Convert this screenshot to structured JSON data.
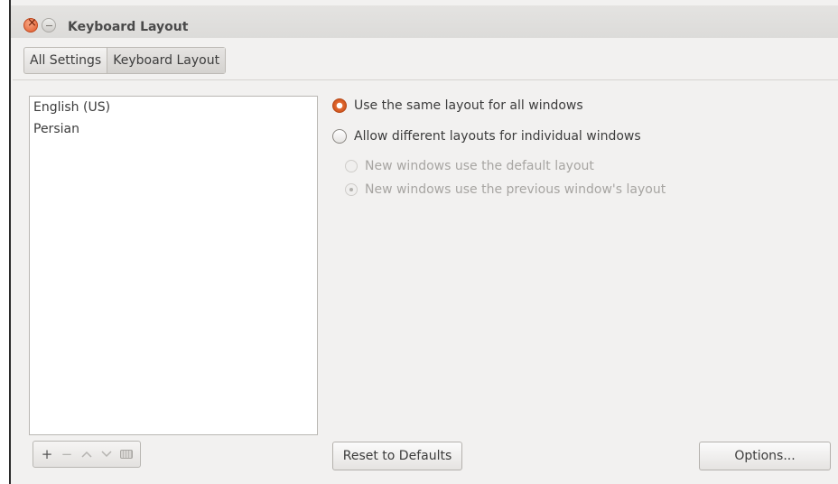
{
  "window": {
    "title": "Keyboard Layout"
  },
  "breadcrumb": {
    "items": [
      {
        "label": "All Settings"
      },
      {
        "label": "Keyboard Layout"
      }
    ]
  },
  "layouts": {
    "items": [
      {
        "label": "English (US)"
      },
      {
        "label": "Persian"
      }
    ]
  },
  "toolbar": {
    "add": "+",
    "remove": "−",
    "up": "^",
    "down": "v",
    "keyboard_icon": "keyboard-icon"
  },
  "options": {
    "same_layout": {
      "label": "Use the same layout for all windows",
      "checked": true
    },
    "different_layouts": {
      "label": "Allow different layouts for individual windows",
      "checked": false
    },
    "default_layout": {
      "label": "New windows use the default layout",
      "checked": false,
      "enabled": false
    },
    "previous_layout": {
      "label": "New windows use the previous window's layout",
      "checked": true,
      "enabled": false
    }
  },
  "buttons": {
    "reset": "Reset to Defaults",
    "options": "Options..."
  },
  "colors": {
    "accent": "#e05a2a",
    "window_bg": "#f2f1f0"
  }
}
